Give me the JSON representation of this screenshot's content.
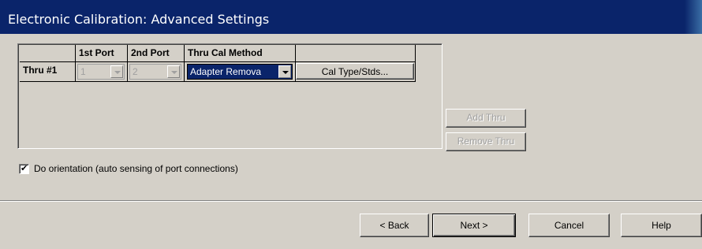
{
  "window": {
    "title": "Electronic Calibration: Advanced Settings"
  },
  "grid": {
    "headers": [
      "1st Port",
      "2nd Port",
      "Thru Cal Method"
    ],
    "rows": [
      {
        "label": "Thru #1",
        "first_port": "1",
        "second_port": "2",
        "method": "Adapter Remova",
        "cal_button": "Cal Type/Stds..."
      }
    ]
  },
  "side_buttons": {
    "add": "Add Thru",
    "remove": "Remove Thru"
  },
  "orientation": {
    "label": "Do orientation (auto sensing of port connections)",
    "checked": true
  },
  "footer": {
    "back": "< Back",
    "next": "Next >",
    "cancel": "Cancel",
    "help": "Help"
  }
}
